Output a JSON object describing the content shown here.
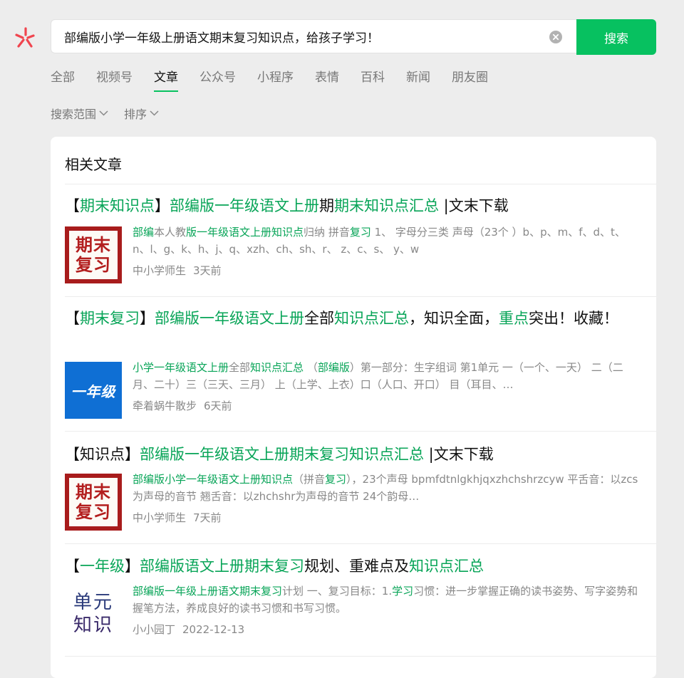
{
  "search": {
    "query": "部编版小学一年级上册语文期末复习知识点，给孩子学习！",
    "button_label": "搜索"
  },
  "tabs": [
    "全部",
    "视频号",
    "文章",
    "公众号",
    "小程序",
    "表情",
    "百科",
    "新闻",
    "朋友圈"
  ],
  "active_tab": "文章",
  "filters": [
    "搜索范围",
    "排序"
  ],
  "panel": {
    "title": "相关文章"
  },
  "articles": [
    {
      "title_parts": [
        {
          "t": "【",
          "h": false
        },
        {
          "t": "期末知识点",
          "h": true
        },
        {
          "t": "】",
          "h": false
        },
        {
          "t": "部编版一年级语文上册",
          "h": true
        },
        {
          "t": "期",
          "h": false
        },
        {
          "t": "期末知识点汇总",
          "h": true
        },
        {
          "t": " |文末下载",
          "h": false
        }
      ],
      "snippet_parts": [
        {
          "t": "部编",
          "h": true
        },
        {
          "t": "本人教",
          "h": false
        },
        {
          "t": "版一年级语文上册知识点",
          "h": true
        },
        {
          "t": "归纳 拼音",
          "h": false
        },
        {
          "t": "复习",
          "h": true
        },
        {
          "t": " 1、 字母分三类 声母（23个 ）b、p、m、f、d、t、n、l、g、k、h、j、q、xzh、ch、sh、r、 z、c、s、 y、w",
          "h": false
        }
      ],
      "source": "中小学师生",
      "time": "3天前",
      "thumb": {
        "type": "red",
        "line1": "期末",
        "line2": "复习"
      }
    },
    {
      "title_parts": [
        {
          "t": "【",
          "h": false
        },
        {
          "t": "期末复习",
          "h": true
        },
        {
          "t": "】",
          "h": false
        },
        {
          "t": "部编版一年级语文上册",
          "h": true
        },
        {
          "t": "全部",
          "h": false
        },
        {
          "t": "知识点汇总",
          "h": true
        },
        {
          "t": "，知识全面，",
          "h": false
        },
        {
          "t": "重点",
          "h": true
        },
        {
          "t": "突出！收藏！",
          "h": false
        }
      ],
      "snippet_parts": [
        {
          "t": "小学一年级语文上册",
          "h": true
        },
        {
          "t": "全部",
          "h": false
        },
        {
          "t": "知识点汇总",
          "h": true
        },
        {
          "t": " （",
          "h": false
        },
        {
          "t": "部编版",
          "h": true
        },
        {
          "t": "）第一部分：生字组词 第1单元 一（一个、一天） 二（二月、二十）三（三天、三月） 上（上学、上衣）口（人口、开口） 目（耳目、…",
          "h": false
        }
      ],
      "source": "牵着蜗牛散步",
      "time": "6天前",
      "thumb": {
        "type": "blue",
        "line1": "一年级",
        "line2": ""
      }
    },
    {
      "title_parts": [
        {
          "t": "【知识点】",
          "h": false
        },
        {
          "t": "部编版一年级语文上册期末复习知识点汇总",
          "h": true
        },
        {
          "t": " |文末下载",
          "h": false
        }
      ],
      "snippet_parts": [
        {
          "t": "部编版小学一年级语文上册知识点",
          "h": true
        },
        {
          "t": "（拼音",
          "h": false
        },
        {
          "t": "复习",
          "h": true
        },
        {
          "t": "），23个声母 bpmfdtnlgkhjqxzhchshrzcyw 平舌音：以zcs为声母的音节 翘舌音：以zhchshr为声母的音节 24个韵母…",
          "h": false
        }
      ],
      "source": "中小学师生",
      "time": "7天前",
      "thumb": {
        "type": "red",
        "line1": "期末",
        "line2": "复习"
      }
    },
    {
      "title_parts": [
        {
          "t": "【",
          "h": false
        },
        {
          "t": "一年级",
          "h": true
        },
        {
          "t": "】",
          "h": false
        },
        {
          "t": "部编版语文上册期末复习",
          "h": true
        },
        {
          "t": "规划、重难点及",
          "h": false
        },
        {
          "t": "知识点汇总",
          "h": true
        }
      ],
      "snippet_parts": [
        {
          "t": "部编版一年级上册语文期末复习",
          "h": true
        },
        {
          "t": "计划 一、复习目标：1.",
          "h": false
        },
        {
          "t": "学习",
          "h": true
        },
        {
          "t": "习惯：进一步掌握正确的读书姿势、写字姿势和握笔方法，养成良好的读书习惯和书写习惯。",
          "h": false
        }
      ],
      "source": "小小园丁",
      "time": "2022-12-13",
      "thumb": {
        "type": "white",
        "line1": "单元",
        "line2": "知识"
      }
    }
  ]
}
